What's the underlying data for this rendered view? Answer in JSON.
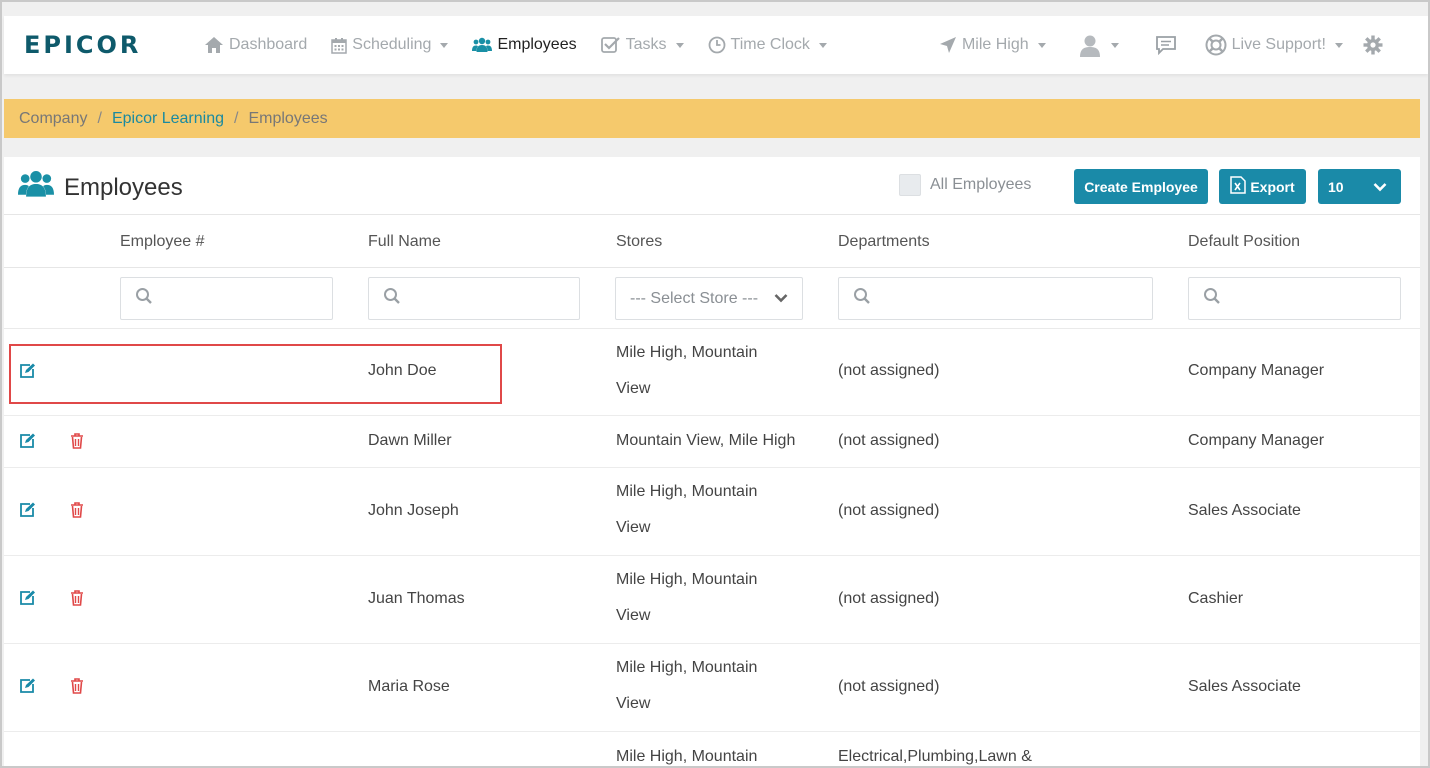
{
  "brand": {
    "logo_text": "EPICOR"
  },
  "nav": {
    "dashboard": "Dashboard",
    "scheduling": "Scheduling",
    "employees": "Employees",
    "tasks": "Tasks",
    "time_clock": "Time Clock",
    "store": "Mile High",
    "live_support": "Live Support!"
  },
  "breadcrumb": {
    "company": "Company",
    "learning": "Epicor Learning",
    "current": "Employees",
    "sep": "/"
  },
  "panel": {
    "title": "Employees",
    "all_employees_label": "All Employees",
    "create_button": "Create Employee",
    "export_button": "Export",
    "page_size": "10"
  },
  "table": {
    "columns": [
      "Employee #",
      "Full Name",
      "Stores",
      "Departments",
      "Default Position"
    ],
    "store_select_placeholder": "--- Select Store ---",
    "rows": [
      {
        "name": "John Doe",
        "stores_1": "Mile High, Mountain",
        "stores_2": "View",
        "department_1": "(not assigned)",
        "department_2": "",
        "position": "Company Manager",
        "deletable": false
      },
      {
        "name": "Dawn Miller",
        "stores_1": "Mountain View, Mile High",
        "stores_2": "",
        "department_1": "(not assigned)",
        "department_2": "",
        "position": "Company Manager",
        "deletable": true
      },
      {
        "name": "John Joseph",
        "stores_1": "Mile High, Mountain",
        "stores_2": "View",
        "department_1": "(not assigned)",
        "department_2": "",
        "position": "Sales Associate",
        "deletable": true
      },
      {
        "name": "Juan Thomas",
        "stores_1": "Mile High, Mountain",
        "stores_2": "View",
        "department_1": "(not assigned)",
        "department_2": "",
        "position": "Cashier",
        "deletable": true
      },
      {
        "name": "Maria Rose",
        "stores_1": "Mile High, Mountain",
        "stores_2": "View",
        "department_1": "(not assigned)",
        "department_2": "",
        "position": "Sales Associate",
        "deletable": true
      },
      {
        "name": "",
        "stores_1": "Mile High, Mountain",
        "stores_2": "",
        "department_1": "Electrical,Plumbing,Lawn &",
        "department_2": "",
        "position": "",
        "deletable": true
      }
    ]
  },
  "colors": {
    "accent": "#1a8aa8",
    "breadcrumb_bg": "#f5c96c",
    "delete": "#e04848",
    "highlight": "#e04848"
  },
  "icons": {
    "dashboard": "home-icon",
    "scheduling": "calendar-icon",
    "employees": "users-icon",
    "tasks": "checkbox-icon",
    "time_clock": "clock-icon",
    "store": "location-arrow-icon",
    "user": "user-icon",
    "messages": "chat-icon",
    "support": "lifebuoy-icon",
    "settings": "gear-icon",
    "edit": "edit-icon",
    "delete": "trash-icon",
    "search": "search-icon",
    "export": "excel-icon"
  }
}
